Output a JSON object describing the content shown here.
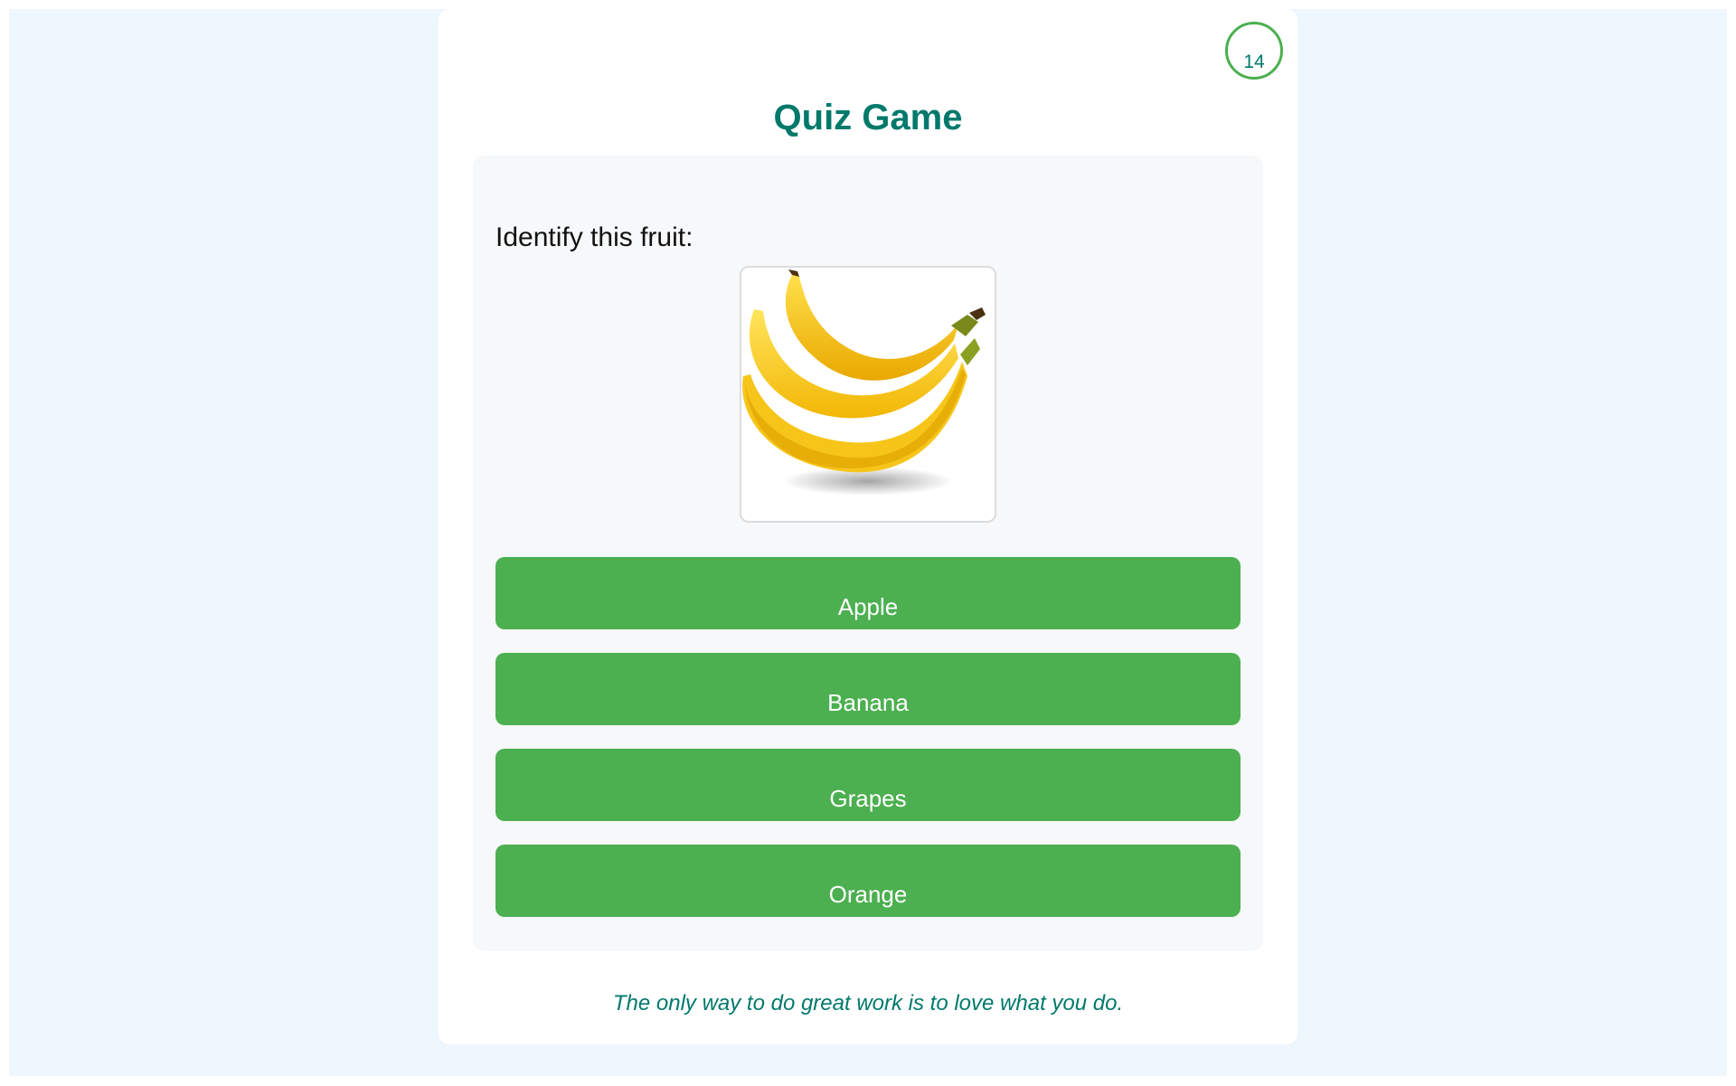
{
  "timer": {
    "value": "14"
  },
  "header": {
    "title": "Quiz Game"
  },
  "question": {
    "text": "Identify this fruit:",
    "image": {
      "name": "banana-bunch-image"
    }
  },
  "options": [
    {
      "label": "Apple"
    },
    {
      "label": "Banana"
    },
    {
      "label": "Grapes"
    },
    {
      "label": "Orange"
    }
  ],
  "footer": {
    "quote": "The only way to do great work is to love what you do."
  },
  "colors": {
    "accent": "#00796b",
    "button": "#4caf50",
    "page_background": "#eef6fe",
    "panel_background": "#f6f8fa"
  }
}
